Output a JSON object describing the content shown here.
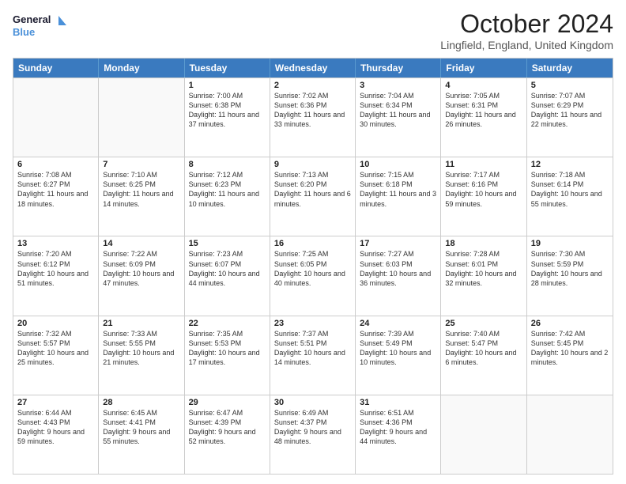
{
  "logo": {
    "line1": "General",
    "line2": "Blue",
    "icon_color": "#4a90d9"
  },
  "title": "October 2024",
  "subtitle": "Lingfield, England, United Kingdom",
  "days_of_week": [
    "Sunday",
    "Monday",
    "Tuesday",
    "Wednesday",
    "Thursday",
    "Friday",
    "Saturday"
  ],
  "weeks": [
    [
      {
        "day": "",
        "empty": true
      },
      {
        "day": "",
        "empty": true
      },
      {
        "day": "1",
        "sunrise": "7:00 AM",
        "sunset": "6:38 PM",
        "daylight": "11 hours and 37 minutes."
      },
      {
        "day": "2",
        "sunrise": "7:02 AM",
        "sunset": "6:36 PM",
        "daylight": "11 hours and 33 minutes."
      },
      {
        "day": "3",
        "sunrise": "7:04 AM",
        "sunset": "6:34 PM",
        "daylight": "11 hours and 30 minutes."
      },
      {
        "day": "4",
        "sunrise": "7:05 AM",
        "sunset": "6:31 PM",
        "daylight": "11 hours and 26 minutes."
      },
      {
        "day": "5",
        "sunrise": "7:07 AM",
        "sunset": "6:29 PM",
        "daylight": "11 hours and 22 minutes."
      }
    ],
    [
      {
        "day": "6",
        "sunrise": "7:08 AM",
        "sunset": "6:27 PM",
        "daylight": "11 hours and 18 minutes."
      },
      {
        "day": "7",
        "sunrise": "7:10 AM",
        "sunset": "6:25 PM",
        "daylight": "11 hours and 14 minutes."
      },
      {
        "day": "8",
        "sunrise": "7:12 AM",
        "sunset": "6:23 PM",
        "daylight": "11 hours and 10 minutes."
      },
      {
        "day": "9",
        "sunrise": "7:13 AM",
        "sunset": "6:20 PM",
        "daylight": "11 hours and 6 minutes."
      },
      {
        "day": "10",
        "sunrise": "7:15 AM",
        "sunset": "6:18 PM",
        "daylight": "11 hours and 3 minutes."
      },
      {
        "day": "11",
        "sunrise": "7:17 AM",
        "sunset": "6:16 PM",
        "daylight": "10 hours and 59 minutes."
      },
      {
        "day": "12",
        "sunrise": "7:18 AM",
        "sunset": "6:14 PM",
        "daylight": "10 hours and 55 minutes."
      }
    ],
    [
      {
        "day": "13",
        "sunrise": "7:20 AM",
        "sunset": "6:12 PM",
        "daylight": "10 hours and 51 minutes."
      },
      {
        "day": "14",
        "sunrise": "7:22 AM",
        "sunset": "6:09 PM",
        "daylight": "10 hours and 47 minutes."
      },
      {
        "day": "15",
        "sunrise": "7:23 AM",
        "sunset": "6:07 PM",
        "daylight": "10 hours and 44 minutes."
      },
      {
        "day": "16",
        "sunrise": "7:25 AM",
        "sunset": "6:05 PM",
        "daylight": "10 hours and 40 minutes."
      },
      {
        "day": "17",
        "sunrise": "7:27 AM",
        "sunset": "6:03 PM",
        "daylight": "10 hours and 36 minutes."
      },
      {
        "day": "18",
        "sunrise": "7:28 AM",
        "sunset": "6:01 PM",
        "daylight": "10 hours and 32 minutes."
      },
      {
        "day": "19",
        "sunrise": "7:30 AM",
        "sunset": "5:59 PM",
        "daylight": "10 hours and 28 minutes."
      }
    ],
    [
      {
        "day": "20",
        "sunrise": "7:32 AM",
        "sunset": "5:57 PM",
        "daylight": "10 hours and 25 minutes."
      },
      {
        "day": "21",
        "sunrise": "7:33 AM",
        "sunset": "5:55 PM",
        "daylight": "10 hours and 21 minutes."
      },
      {
        "day": "22",
        "sunrise": "7:35 AM",
        "sunset": "5:53 PM",
        "daylight": "10 hours and 17 minutes."
      },
      {
        "day": "23",
        "sunrise": "7:37 AM",
        "sunset": "5:51 PM",
        "daylight": "10 hours and 14 minutes."
      },
      {
        "day": "24",
        "sunrise": "7:39 AM",
        "sunset": "5:49 PM",
        "daylight": "10 hours and 10 minutes."
      },
      {
        "day": "25",
        "sunrise": "7:40 AM",
        "sunset": "5:47 PM",
        "daylight": "10 hours and 6 minutes."
      },
      {
        "day": "26",
        "sunrise": "7:42 AM",
        "sunset": "5:45 PM",
        "daylight": "10 hours and 2 minutes."
      }
    ],
    [
      {
        "day": "27",
        "sunrise": "6:44 AM",
        "sunset": "4:43 PM",
        "daylight": "9 hours and 59 minutes."
      },
      {
        "day": "28",
        "sunrise": "6:45 AM",
        "sunset": "4:41 PM",
        "daylight": "9 hours and 55 minutes."
      },
      {
        "day": "29",
        "sunrise": "6:47 AM",
        "sunset": "4:39 PM",
        "daylight": "9 hours and 52 minutes."
      },
      {
        "day": "30",
        "sunrise": "6:49 AM",
        "sunset": "4:37 PM",
        "daylight": "9 hours and 48 minutes."
      },
      {
        "day": "31",
        "sunrise": "6:51 AM",
        "sunset": "4:36 PM",
        "daylight": "9 hours and 44 minutes."
      },
      {
        "day": "",
        "empty": true
      },
      {
        "day": "",
        "empty": true
      }
    ]
  ]
}
